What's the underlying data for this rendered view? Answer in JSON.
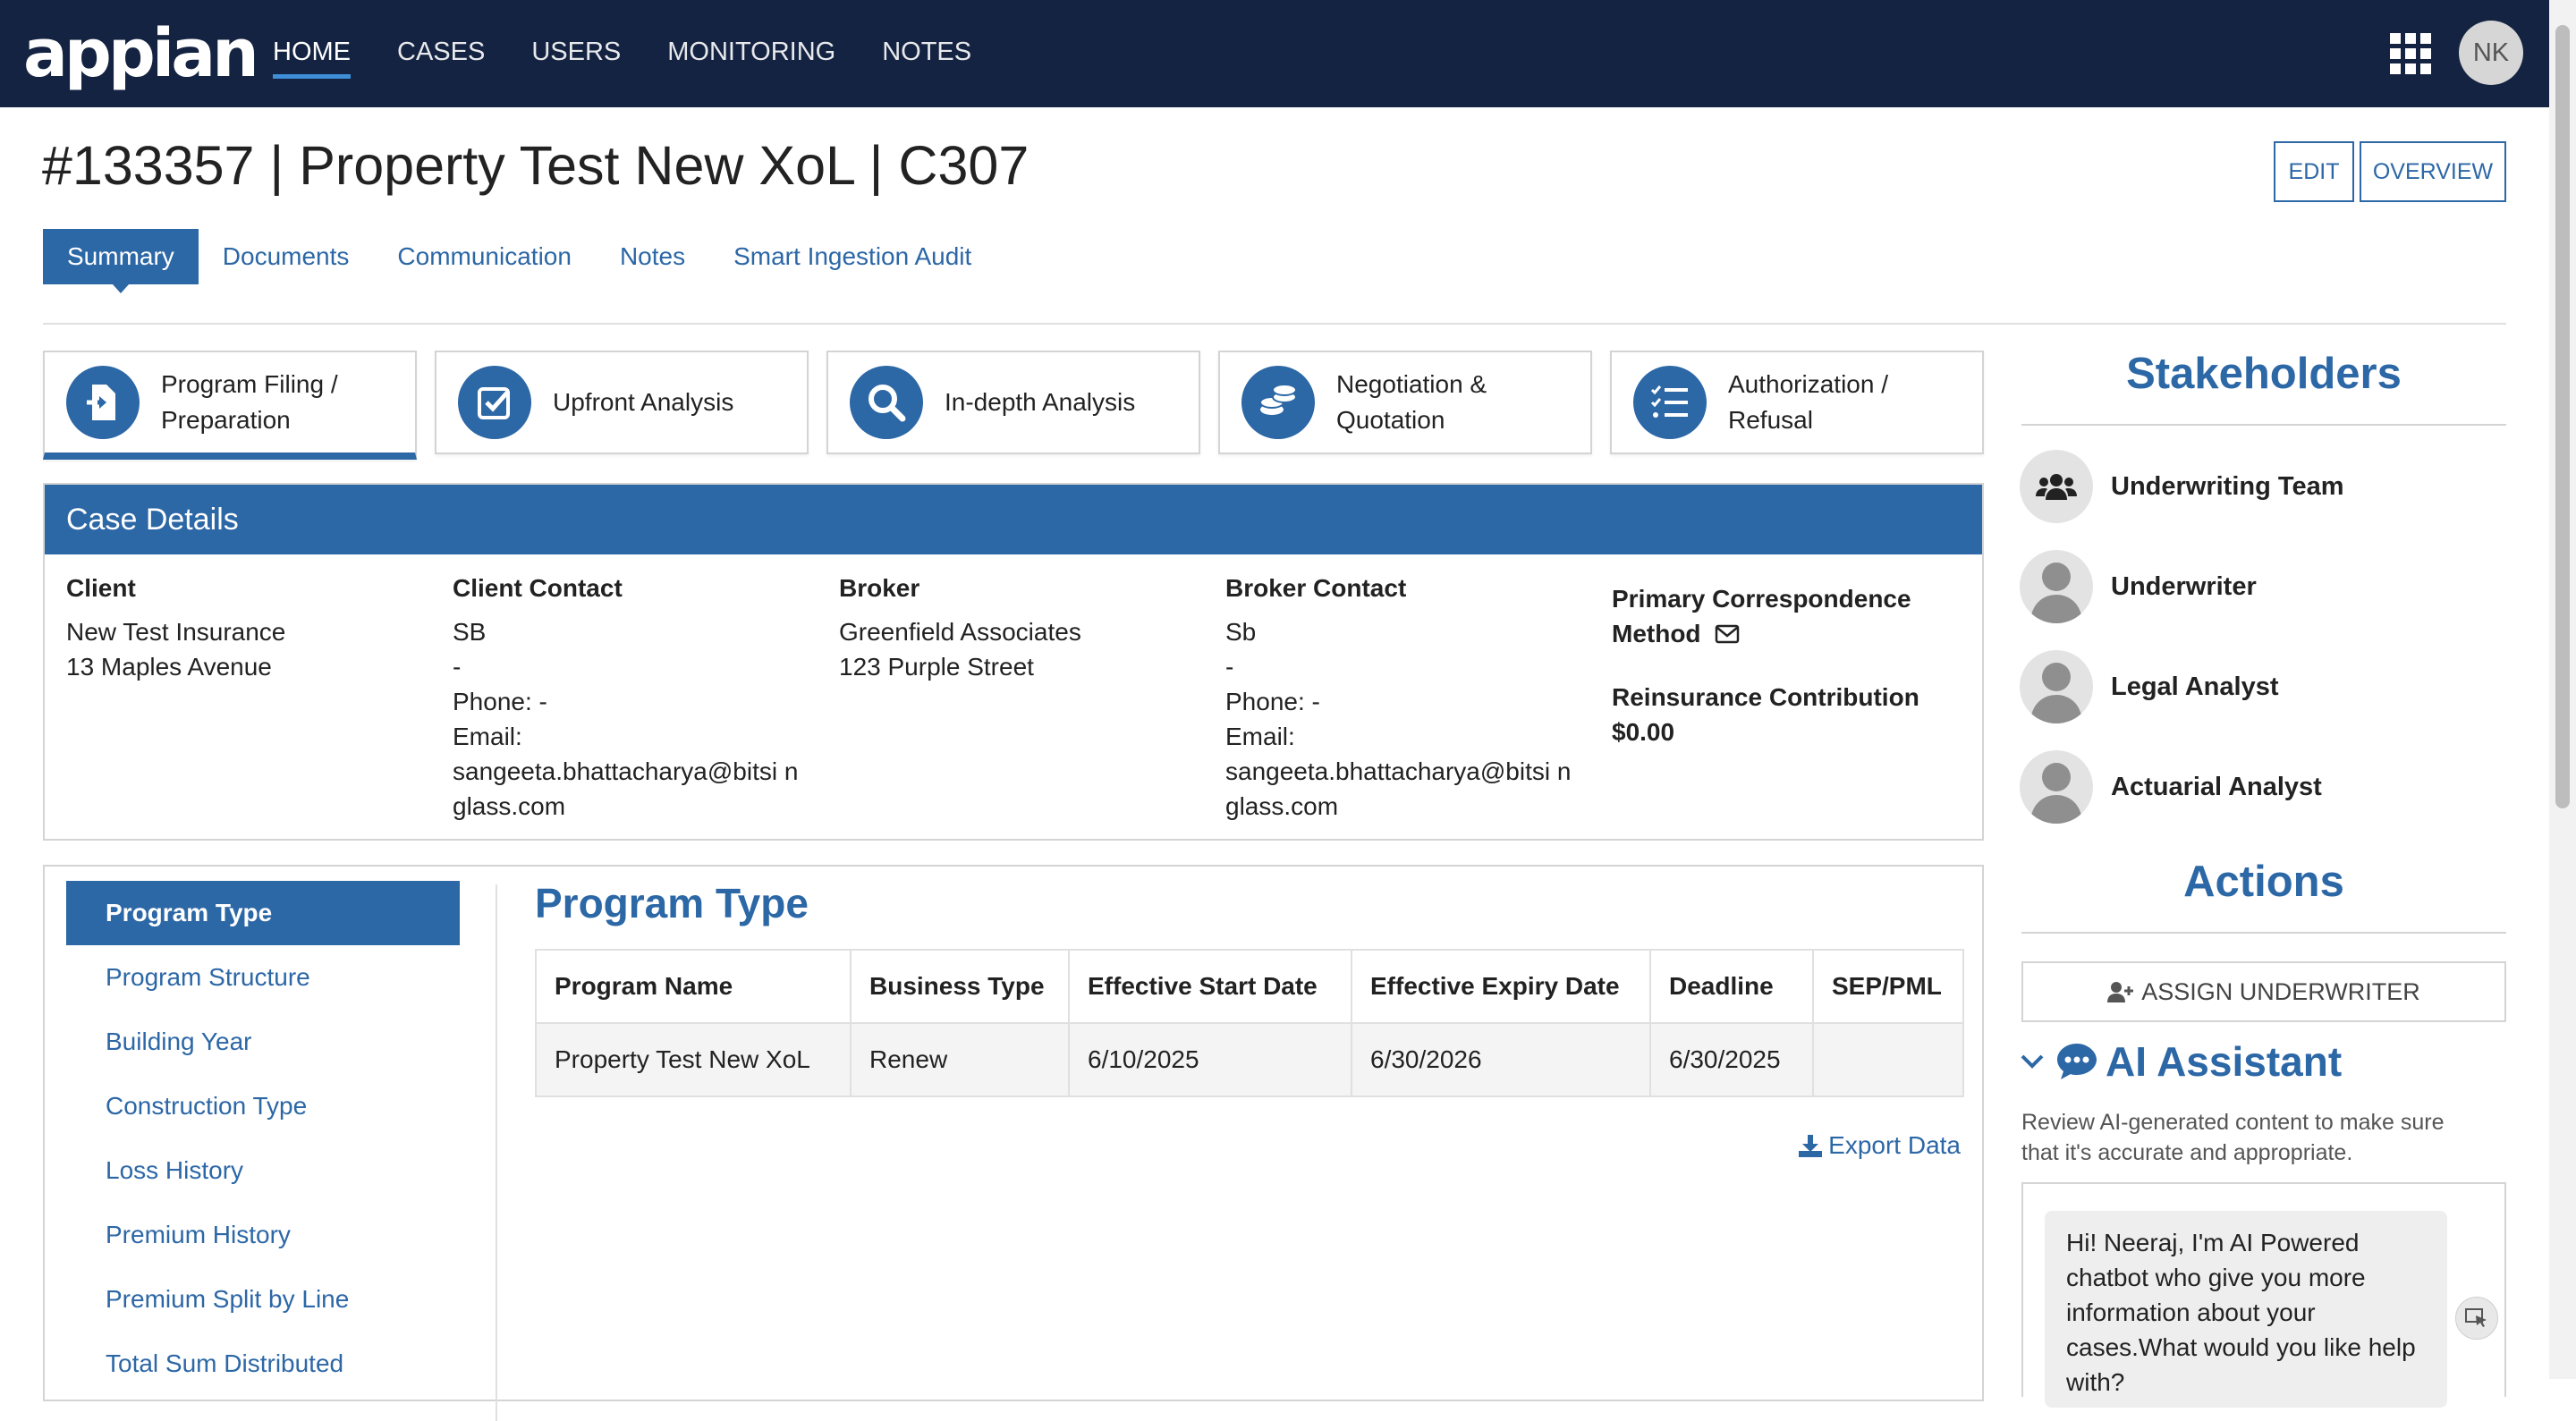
{
  "app": {
    "logo": "appian"
  },
  "nav": {
    "items": [
      "HOME",
      "CASES",
      "USERS",
      "MONITORING",
      "NOTES"
    ],
    "user_initials": "NK"
  },
  "page": {
    "title": "#133357 | Property Test New XoL | C307",
    "edit_label": "EDIT",
    "overview_label": "OVERVIEW"
  },
  "tabs": [
    "Summary",
    "Documents",
    "Communication",
    "Notes",
    "Smart Ingestion Audit"
  ],
  "stages": [
    {
      "label": "Program Filing / Preparation",
      "icon": "file-import-icon"
    },
    {
      "label": "Upfront Analysis",
      "icon": "check-square-icon"
    },
    {
      "label": "In-depth Analysis",
      "icon": "search-icon"
    },
    {
      "label": "Negotiation & Quotation",
      "icon": "coins-icon"
    },
    {
      "label": "Authorization / Refusal",
      "icon": "checklist-icon"
    }
  ],
  "case_details": {
    "title": "Case Details",
    "client": {
      "label": "Client",
      "line1": "New Test Insurance",
      "line2": "13 Maples Avenue"
    },
    "client_contact": {
      "label": "Client Contact",
      "name": "SB",
      "dash": "-",
      "phone": "Phone: -",
      "email_label": "Email:",
      "email": "sangeeta.bhattacharya@bitsi nglass.com"
    },
    "broker": {
      "label": "Broker",
      "line1": "Greenfield Associates",
      "line2": "123 Purple Street"
    },
    "broker_contact": {
      "label": "Broker Contact",
      "name": "Sb",
      "dash": "-",
      "phone": "Phone: -",
      "email_label": "Email:",
      "email": "sangeeta.bhattacharya@bitsi nglass.com"
    },
    "primary_method_label": "Primary Correspondence Method",
    "reinsurance_label": "Reinsurance Contribution",
    "reinsurance_value": "$0.00"
  },
  "left_nav": [
    "Program Type",
    "Program Structure",
    "Building Year",
    "Construction Type",
    "Loss History",
    "Premium History",
    "Premium Split by Line",
    "Total Sum Distributed"
  ],
  "program_type": {
    "title": "Program Type",
    "headers": [
      "Program Name",
      "Business Type",
      "Effective Start Date",
      "Effective Expiry Date",
      "Deadline",
      "SEP/PML"
    ],
    "row": [
      "Property Test New XoL",
      "Renew",
      "6/10/2025",
      "6/30/2026",
      "6/30/2025",
      ""
    ],
    "export_label": "Export Data"
  },
  "stakeholders": {
    "title": "Stakeholders",
    "items": [
      "Underwriting Team",
      "Underwriter",
      "Legal Analyst",
      "Actuarial Analyst"
    ]
  },
  "actions": {
    "title": "Actions",
    "assign_label": "ASSIGN UNDERWRITER"
  },
  "ai": {
    "title": "AI Assistant",
    "note": "Review AI-generated content to make sure that it's accurate and appropriate.",
    "message": "Hi! Neeraj, I'm AI Powered chatbot who give you more information about your cases.What would you like help with?"
  },
  "colors": {
    "brand": "#2c67a6",
    "topbar": "#142341"
  }
}
